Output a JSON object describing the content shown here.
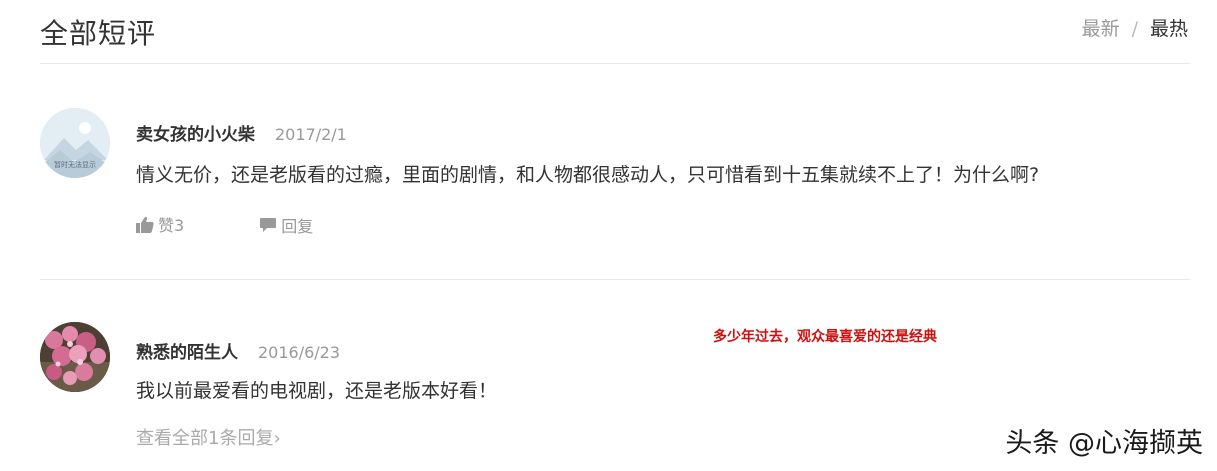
{
  "header": {
    "title": "全部短评",
    "sort_latest": "最新",
    "sort_separator": "/",
    "sort_hot": "最热"
  },
  "comments": [
    {
      "username": "卖女孩的小火柴",
      "date": "2017/2/1",
      "text": "情义无价，还是老版看的过瘾，里面的剧情，和人物都很感动人，只可惜看到十五集就续不上了！为什么啊?",
      "like_label": "赞3",
      "reply_label": "回复",
      "avatar_caption": "暂时无法显示"
    },
    {
      "username": "熟悉的陌生人",
      "date": "2016/6/23",
      "text": "我以前最爱看的电视剧，还是老版本好看！",
      "view_replies_label": "查看全部1条回复",
      "view_replies_arrow": "›"
    }
  ],
  "overlay_caption": "多少年过去，观众最喜爱的还是经典",
  "watermark": "头条 @心海撷英",
  "colors": {
    "caption_red": "#d01010",
    "muted_gray": "#999999",
    "text_dark": "#333333",
    "divider": "#e8e8e8"
  }
}
